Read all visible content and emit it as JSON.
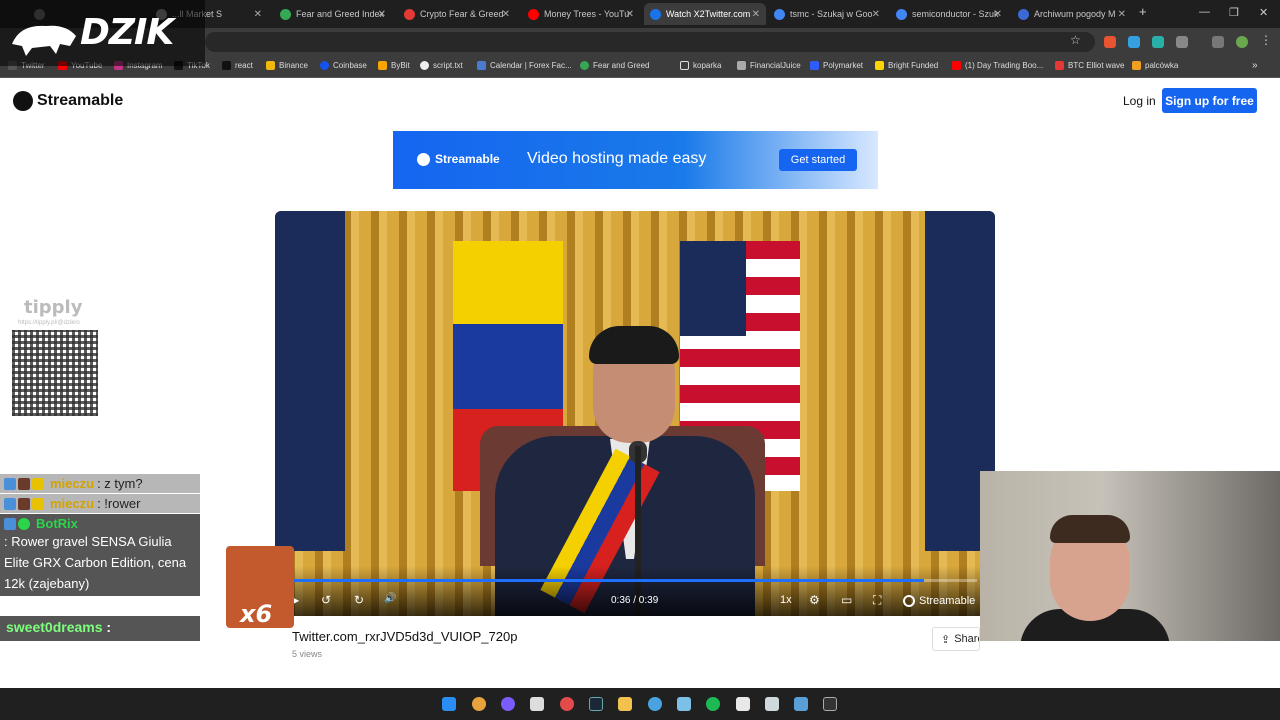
{
  "overlay": {
    "logo_text": "DZIK"
  },
  "browser": {
    "tabs": [
      {
        "label": "",
        "color": "#666"
      },
      {
        "label": "...ll Market S",
        "color": "#888"
      },
      {
        "label": "Fear and Greed Index",
        "color": "#34a853"
      },
      {
        "label": "Crypto Fear & Greed",
        "color": "#e53935"
      },
      {
        "label": "Money Trees - YouTu",
        "color": "#ff0000"
      },
      {
        "label": "Watch X2Twitter.com",
        "color": "#1a73e8"
      },
      {
        "label": "tsmc - Szukaj w Goo",
        "color": "#4285f4"
      },
      {
        "label": "semiconductor - Szuk",
        "color": "#4285f4"
      },
      {
        "label": "Archiwum pogody M",
        "color": "#3b6ad6"
      }
    ],
    "window_controls": {
      "new_tab": "+",
      "minimize": "—",
      "restore": "❐",
      "close": "✕"
    },
    "bookmarks": [
      "Twitter",
      "YouTube",
      "Instagram",
      "TikTok",
      "react",
      "Binance",
      "Coinbase",
      "ByBit",
      "script.txt",
      "Calendar | Forex Fac...",
      "Fear and Greed",
      "koparka",
      "FinancialJuice",
      "Polymarket",
      "Bright Funded",
      "(1) Day Trading Boo...",
      "BTC Elliot wave",
      "palcówka"
    ]
  },
  "site": {
    "logo": "Streamable",
    "login": "Log in",
    "signup": "Sign up for free",
    "banner": {
      "logo": "Streamable",
      "tagline": "Video hosting made easy",
      "cta": "Get started"
    }
  },
  "player": {
    "time": "0:36 / 0:39",
    "progress": 0.923,
    "speed": "1x",
    "brand": "Streamable",
    "icons": {
      "play": "▶",
      "back": "↺",
      "forward": "↻",
      "volume": "🔊",
      "settings": "⚙",
      "pip": "▭",
      "fullscreen": "⛶"
    }
  },
  "video": {
    "title": "Twitter.com_rxrJVD5d3d_VUIOP_720p",
    "views": "5 views",
    "share": "Share"
  },
  "tippy": {
    "label": "tipply",
    "url": "https://tipply.pl/@dzikro"
  },
  "chat": {
    "rows": [
      {
        "nick": "mieczu",
        "text": ": z tym?"
      },
      {
        "nick": "mieczu",
        "text": ": !rower"
      },
      {
        "nick": "BotRix",
        "text": ": Rower gravel SENSA Giulia Elite GRX Carbon Edition, cena 12k (zajebany)"
      }
    ],
    "bottom_nick": "sweet0dreams",
    "bottom_sep": ":",
    "emote_multiplier": "x6"
  }
}
